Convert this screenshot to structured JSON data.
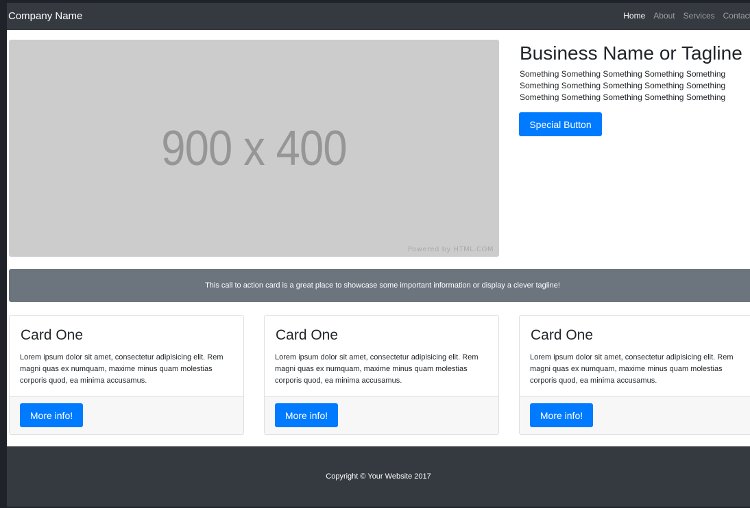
{
  "navbar": {
    "brand": "Company Name",
    "links": [
      {
        "label": "Home",
        "active": true
      },
      {
        "label": "About",
        "active": false
      },
      {
        "label": "Services",
        "active": false
      },
      {
        "label": "Contact",
        "active": false
      }
    ]
  },
  "hero": {
    "image_text": "900 x 400",
    "image_credit": "Powered by HTML.COM",
    "tagline": "Business Name or Tagline",
    "description": "Something Something Something Something Something Something Something Something Something Something Something Something Something Something Something",
    "button_label": "Special Button"
  },
  "cta": {
    "text": "This call to action card is a great place to showcase some important information or display a clever tagline!"
  },
  "cards": [
    {
      "title": "Card One",
      "text": "Lorem ipsum dolor sit amet, consectetur adipisicing elit. Rem magni quas ex numquam, maxime minus quam molestias corporis quod, ea minima accusamus.",
      "button_label": "More info!"
    },
    {
      "title": "Card One",
      "text": "Lorem ipsum dolor sit amet, consectetur adipisicing elit. Rem magni quas ex numquam, maxime minus quam molestias corporis quod, ea minima accusamus.",
      "button_label": "More info!"
    },
    {
      "title": "Card One",
      "text": "Lorem ipsum dolor sit amet, consectetur adipisicing elit. Rem magni quas ex numquam, maxime minus quam molestias corporis quod, ea minima accusamus.",
      "button_label": "More info!"
    }
  ],
  "footer": {
    "copyright": "Copyright © Your Website 2017"
  },
  "colors": {
    "navbar_bg": "#343a40",
    "primary": "#007bff",
    "cta_bg": "#6c757d",
    "placeholder_bg": "#cccccc"
  }
}
